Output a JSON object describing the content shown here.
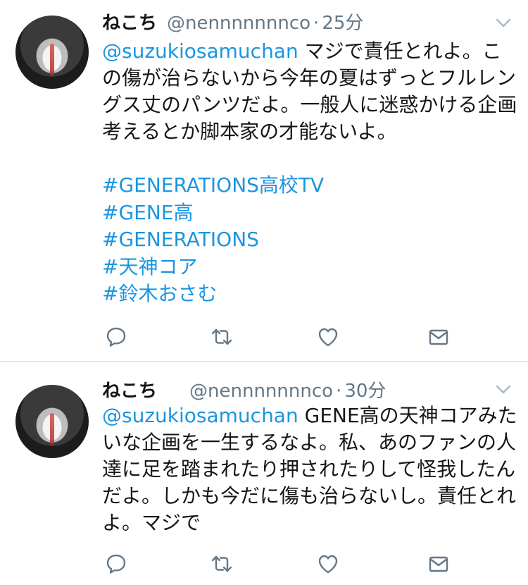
{
  "tweets": [
    {
      "name": "ねこち",
      "handle": "@nennnnnnnco",
      "separator": "·",
      "time": "25分",
      "mention": "@suzukiosamuchan",
      "text": " マジで責任とれよ。この傷が治らないから今年の夏はずっとフルレングス丈のパンツだよ。一般人に迷惑かける企画考えるとか脚本家の才能ないよ。",
      "hashtags": [
        "#GENERATIONS高校TV",
        "#GENE高",
        "#GENERATIONS",
        "#天神コア",
        "#鈴木おさむ"
      ]
    },
    {
      "name": "ねこち",
      "handle": "@nennnnnnnco",
      "separator": "·",
      "time": "30分",
      "mention": "@suzukiosamuchan",
      "text": " GENE高の天神コアみたいな企画を一生するなよ。私、あのファンの人達に足を踏まれたり押されたりして怪我したんだよ。しかも今だに傷も治らないし。責任とれよ。マジで",
      "hashtags": []
    }
  ],
  "icons": {
    "menu": "chevron-down-icon",
    "reply": "reply-icon",
    "retweet": "retweet-icon",
    "like": "heart-icon",
    "dm": "envelope-icon"
  },
  "colors": {
    "link": "#1b95e0",
    "secondary": "#657786",
    "icon": "#657786",
    "divider": "#e1e8ed"
  }
}
